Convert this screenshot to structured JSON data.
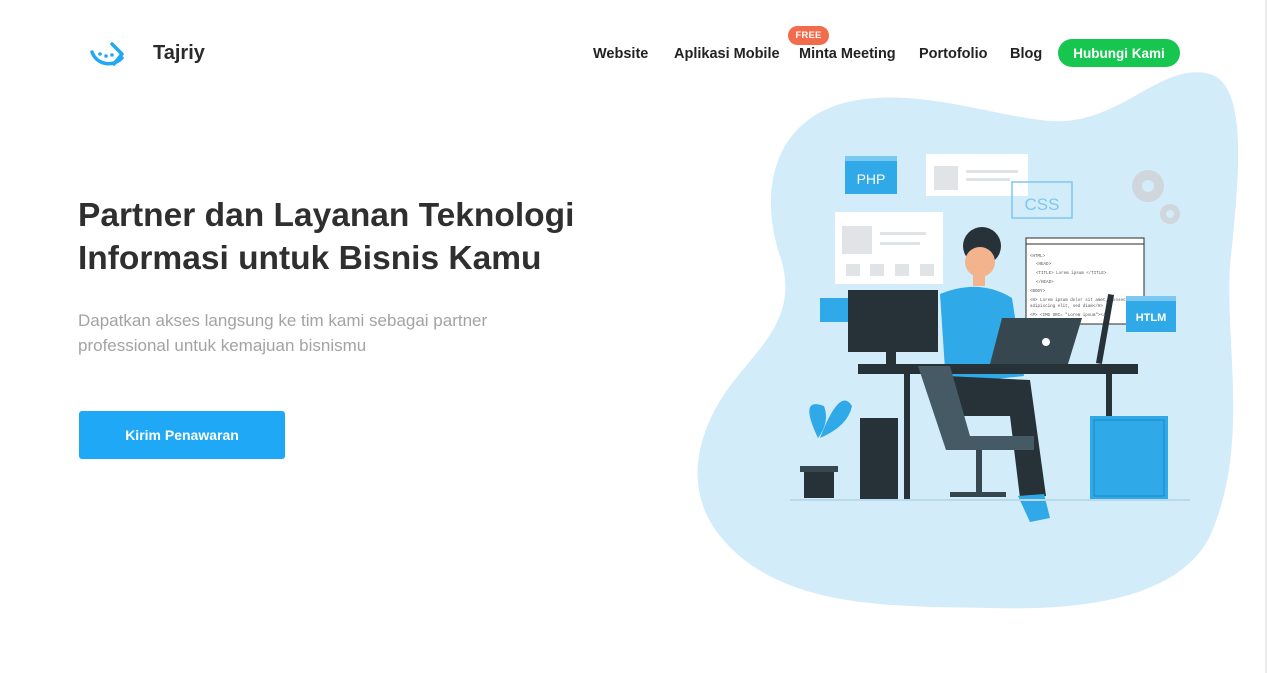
{
  "header": {
    "brand": "Tajriy",
    "logo_icon": "tajriy-logo-icon",
    "nav": [
      {
        "label": "Website"
      },
      {
        "label": "Aplikasi Mobile"
      },
      {
        "label": "Minta Meeting",
        "badge": "FREE"
      },
      {
        "label": "Portofolio"
      },
      {
        "label": "Blog"
      }
    ],
    "cta_label": "Hubungi Kami"
  },
  "hero": {
    "title": "Partner dan Layanan Teknologi Informasi untuk Bisnis Kamu",
    "subtitle": "Dapatkan akses langsung ke tim kami sebagai partner professional untuk kemajuan bisnismu",
    "button_label": "Kirim Penawaran"
  },
  "illustration": {
    "labels": {
      "php": "PHP",
      "css": "CSS",
      "html": "HTLM"
    },
    "code_lines": [
      "<HTML>",
      "<HEAD>",
      "<TITLE> Lorem ipsum </TITLE>",
      "</HEAD>",
      "<BODY>",
      "<H> Lorem ipsum dolor sit amet, consectetur",
      "adipiscing elit, sed diam</H>",
      "<P> <IMG SRC= \"Lorem ipsum\"></P>"
    ]
  },
  "colors": {
    "primary_blue": "#1fa8f5",
    "cta_green": "#16c64f",
    "badge_orange": "#f26b4a",
    "blob": "#d2ecfa"
  }
}
